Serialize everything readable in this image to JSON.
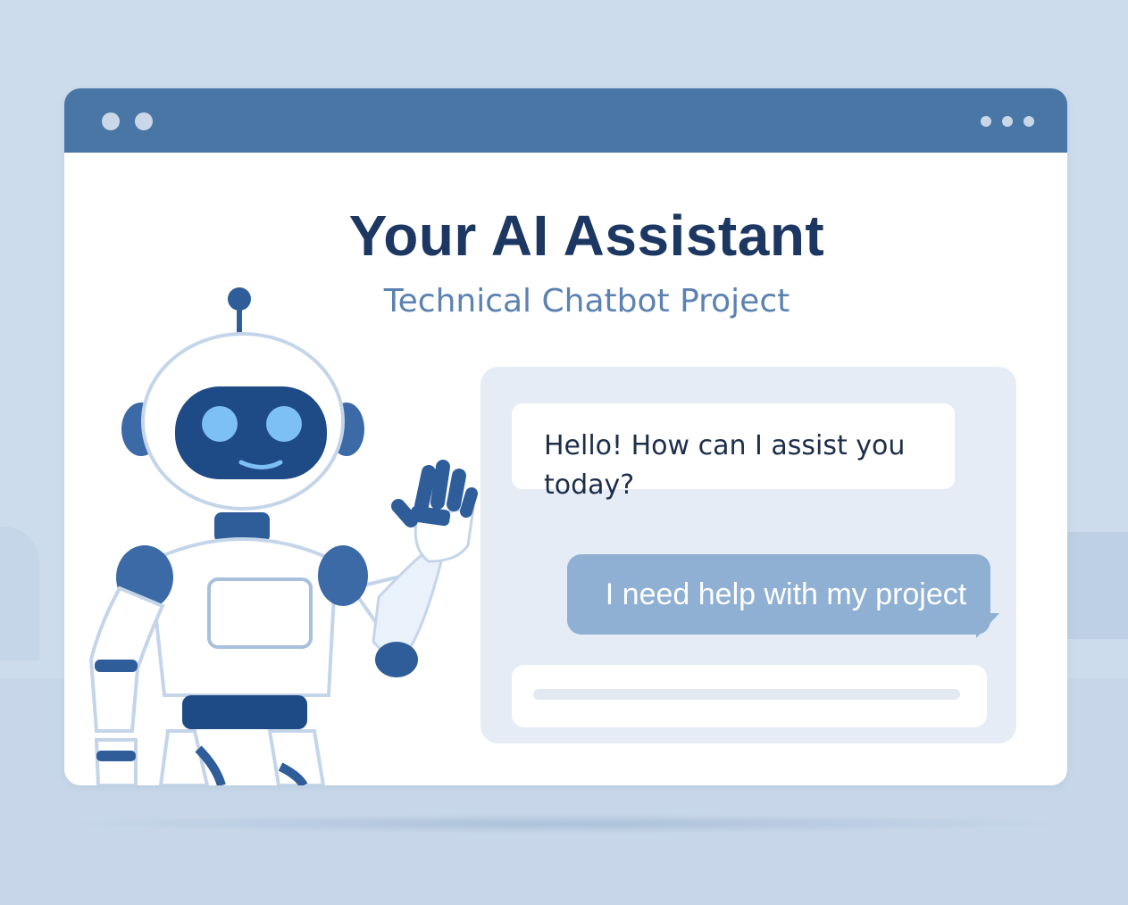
{
  "window": {
    "title_dots": [
      "dot",
      "dot"
    ],
    "menu_icon": "more-horizontal-icon"
  },
  "header": {
    "title": "Your AI Assistant",
    "subtitle": "Technical Chatbot Project"
  },
  "chat": {
    "messages": [
      {
        "role": "bot",
        "text": "Hello! How can I assist you today?"
      },
      {
        "role": "user",
        "text": "I need help with my project"
      }
    ],
    "input_value": ""
  },
  "illustration": {
    "robot_icon": "waving-robot-icon"
  },
  "colors": {
    "background": "#cddcec",
    "titlebar": "#4a76a6",
    "title_text": "#1c3761",
    "subtitle_text": "#5b82b1",
    "chat_panel": "#e5ecf5",
    "user_bubble": "#8fb0d3",
    "robot_accent": "#2f5d99"
  }
}
